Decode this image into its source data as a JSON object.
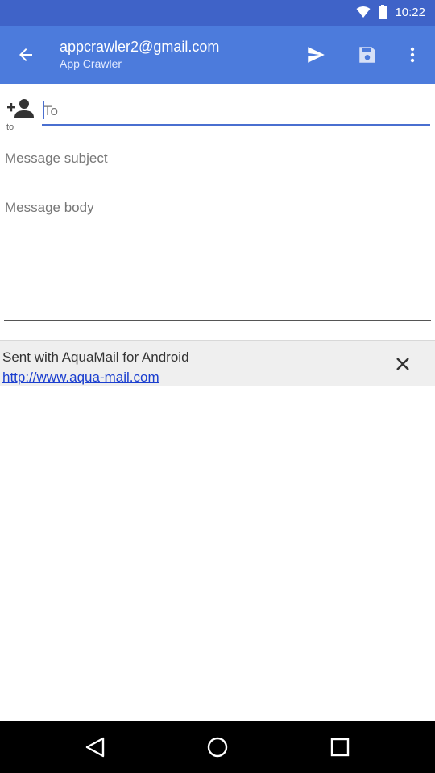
{
  "status_bar": {
    "time": "10:22",
    "background": "#3f63c8"
  },
  "app_bar": {
    "title": "appcrawler2@gmail.com",
    "subtitle": "App Crawler",
    "background": "#4c7bdc",
    "icons": [
      "back-arrow-icon",
      "send-icon",
      "save-icon",
      "more-vert-icon"
    ]
  },
  "compose": {
    "to_label": "to",
    "to_placeholder": "To",
    "to_value": "",
    "subject_placeholder": "Message subject",
    "body_placeholder": "Message body"
  },
  "signature": {
    "text": "Sent with AquaMail for Android",
    "link": "http://www.aqua-mail.com"
  },
  "nav_bar": {
    "icons": [
      "back-triangle-icon",
      "home-circle-icon",
      "recent-square-icon"
    ]
  }
}
